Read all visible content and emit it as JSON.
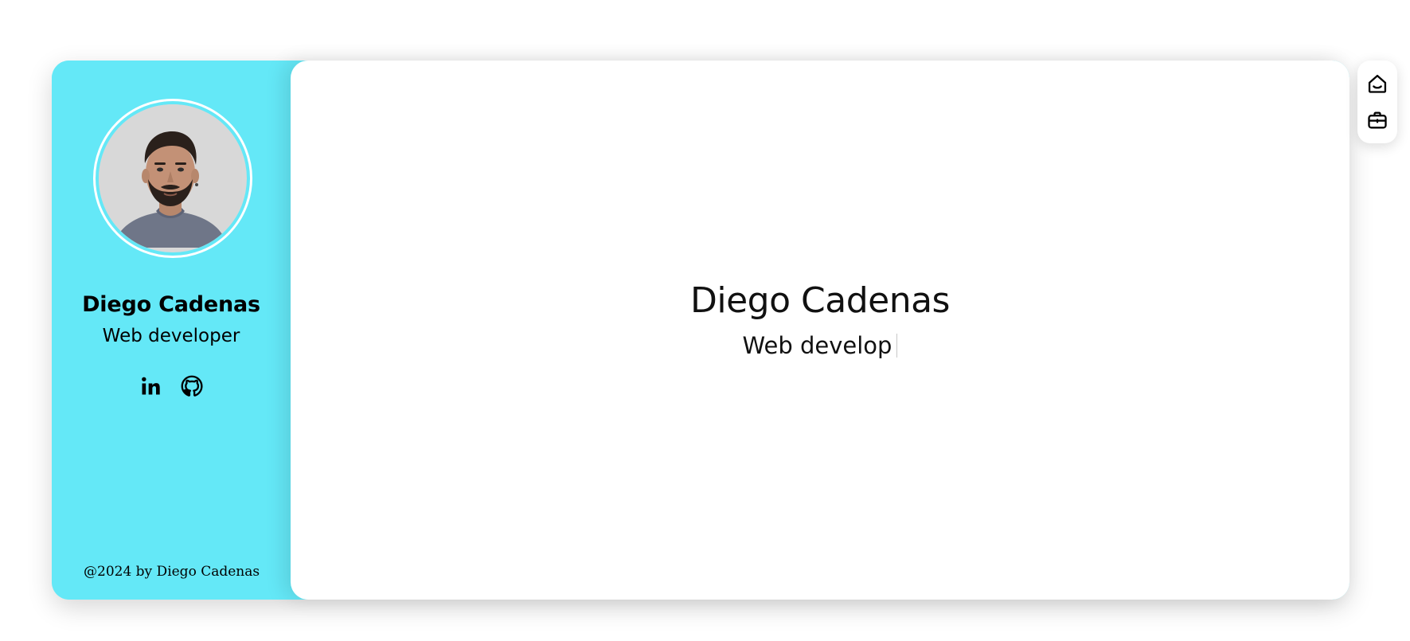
{
  "profile": {
    "name": "Diego Cadenas",
    "role": "Web developer",
    "avatar_alt": "profile photo",
    "footer": "@2024 by Diego Cadenas"
  },
  "socials": [
    {
      "icon": "linkedin-icon",
      "label": "LinkedIn"
    },
    {
      "icon": "github-icon",
      "label": "GitHub"
    }
  ],
  "hero": {
    "name": "Diego Cadenas",
    "typed_role": "Web develop"
  },
  "nav": [
    {
      "icon": "home-icon"
    },
    {
      "icon": "briefcase-icon"
    }
  ],
  "colors": {
    "sidebar_bg": "#64e8f7",
    "main_bg": "#ffffff",
    "text": "#111111"
  }
}
